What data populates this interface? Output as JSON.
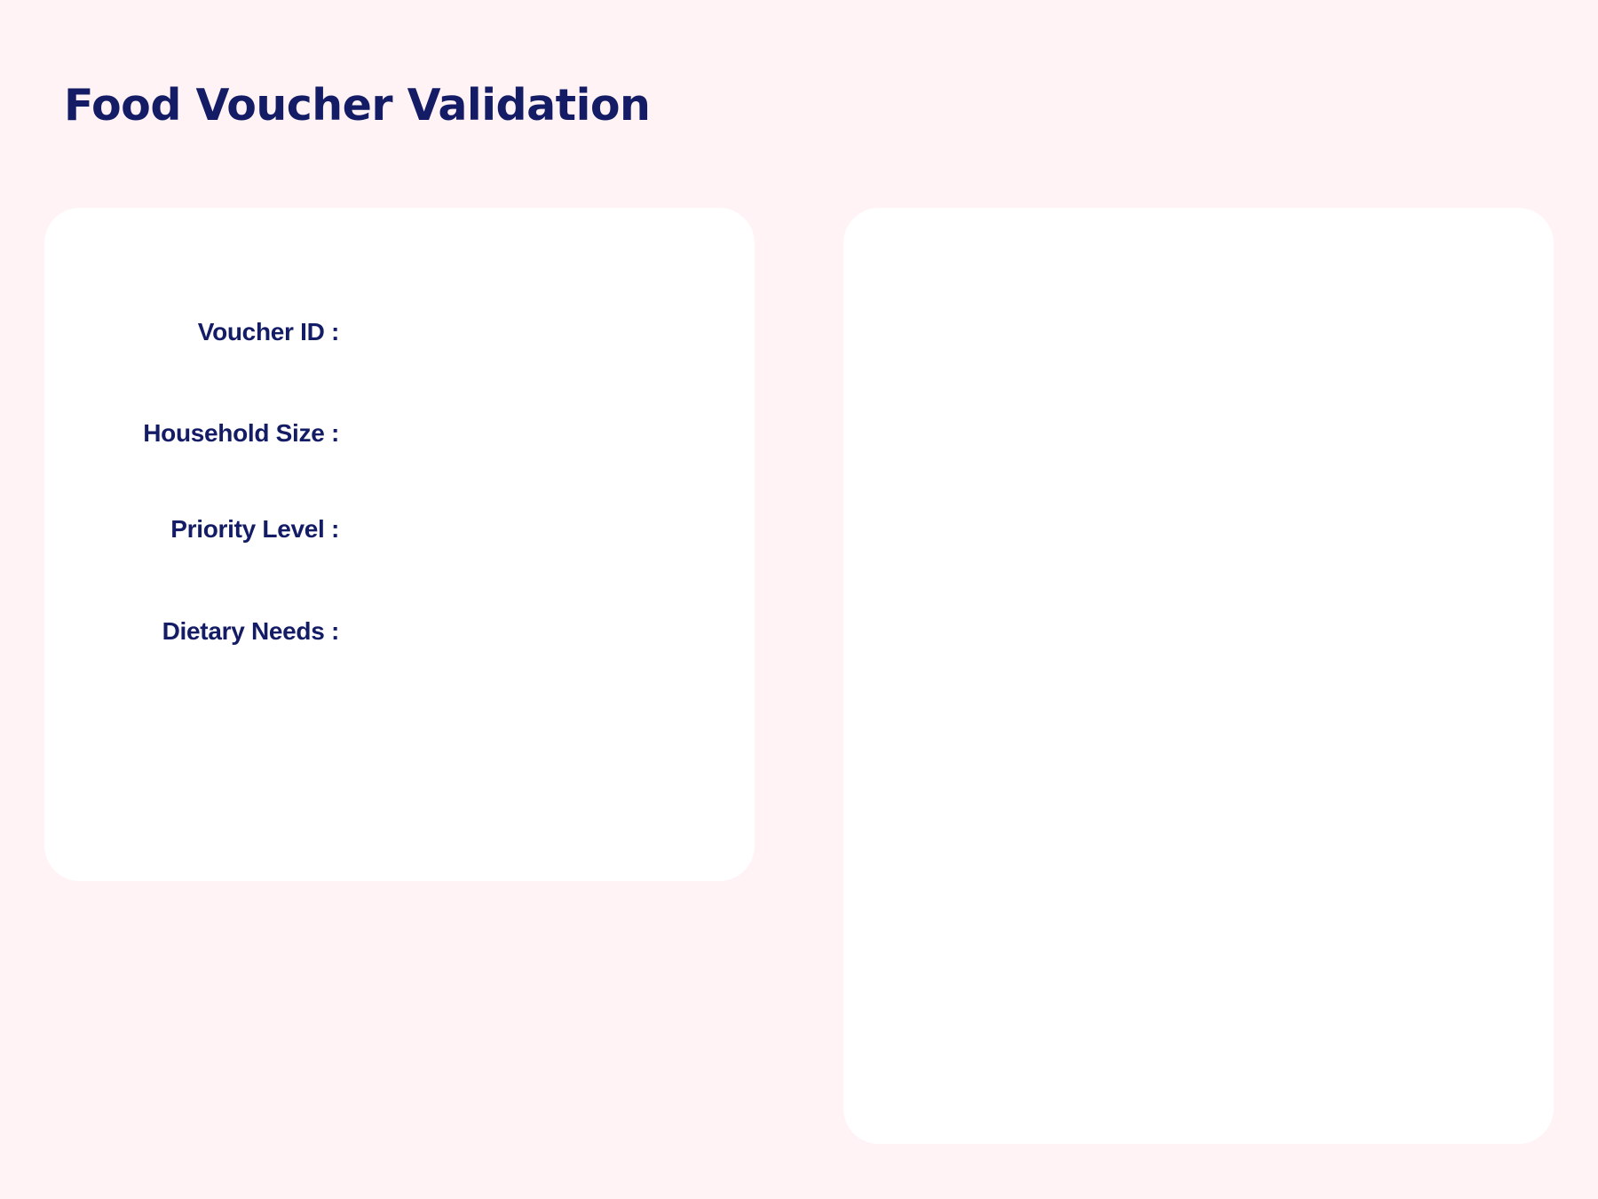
{
  "page": {
    "title": "Food Voucher Validation"
  },
  "colors": {
    "background": "#fff3f6",
    "panel": "#ffffff",
    "text": "#141c66"
  },
  "details_panel": {
    "fields": [
      {
        "label": "Voucher ID :",
        "value": ""
      },
      {
        "label": "Household Size :",
        "value": ""
      },
      {
        "label": "Priority Level :",
        "value": ""
      },
      {
        "label": "Dietary Needs :",
        "value": ""
      }
    ]
  },
  "preview_panel": {}
}
